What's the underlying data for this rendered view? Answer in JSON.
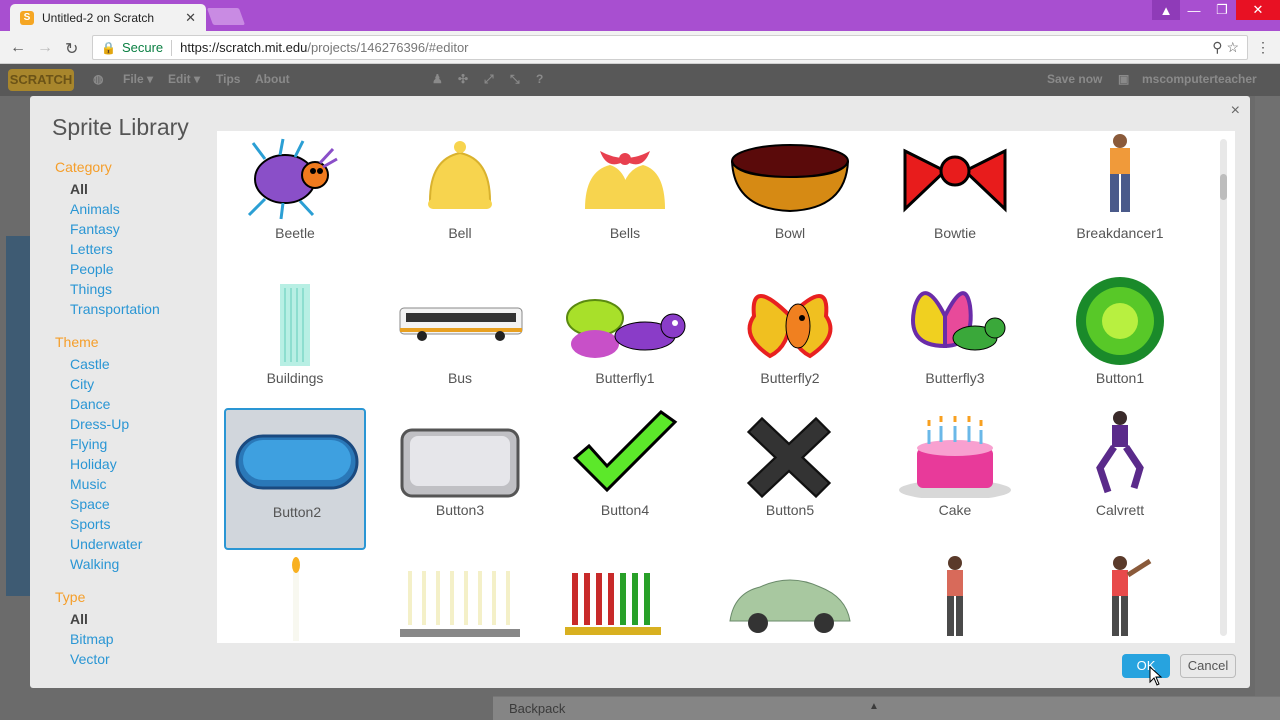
{
  "browser": {
    "tab_title": "Untitled-2 on Scratch",
    "tab_close": "✕",
    "secure_label": "Secure",
    "url_host": "https://scratch.mit.edu",
    "url_path": "/projects/146276396/#editor"
  },
  "scratch": {
    "logo": "SCRATCH",
    "menu": [
      "File ▾",
      "Edit ▾",
      "Tips",
      "About"
    ],
    "save_now": "Save now",
    "username": "mscomputerteacher",
    "backpack": "Backpack"
  },
  "dialog": {
    "title": "Sprite Library",
    "close": "×",
    "ok_label": "OK",
    "cancel_label": "Cancel"
  },
  "filters": {
    "category_heading": "Category",
    "category": [
      "All",
      "Animals",
      "Fantasy",
      "Letters",
      "People",
      "Things",
      "Transportation"
    ],
    "theme_heading": "Theme",
    "theme": [
      "Castle",
      "City",
      "Dance",
      "Dress-Up",
      "Flying",
      "Holiday",
      "Music",
      "Space",
      "Sports",
      "Underwater",
      "Walking"
    ],
    "type_heading": "Type",
    "type": [
      "All",
      "Bitmap",
      "Vector"
    ],
    "selected_category": "All",
    "selected_type": "All"
  },
  "sprites": [
    {
      "name": "Beetle"
    },
    {
      "name": "Bell"
    },
    {
      "name": "Bells"
    },
    {
      "name": "Bowl"
    },
    {
      "name": "Bowtie"
    },
    {
      "name": "Breakdancer1"
    },
    {
      "name": "Buildings"
    },
    {
      "name": "Bus"
    },
    {
      "name": "Butterfly1"
    },
    {
      "name": "Butterfly2"
    },
    {
      "name": "Butterfly3"
    },
    {
      "name": "Button1"
    },
    {
      "name": "Button2",
      "selected": true
    },
    {
      "name": "Button3"
    },
    {
      "name": "Button4"
    },
    {
      "name": "Button5"
    },
    {
      "name": "Cake"
    },
    {
      "name": "Calvrett"
    },
    {
      "name": ""
    },
    {
      "name": ""
    },
    {
      "name": ""
    },
    {
      "name": ""
    },
    {
      "name": ""
    },
    {
      "name": ""
    }
  ],
  "colors": {
    "accent": "#27a3df",
    "category_heading": "#f59e2a",
    "link": "#2a96d4",
    "titlebar": "#a84fd0"
  }
}
